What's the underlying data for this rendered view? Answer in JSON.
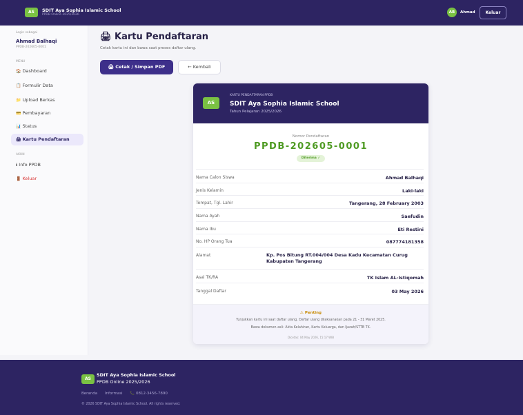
{
  "topbar": {
    "logo": "AS",
    "school_name": "SDIT Aya Sophia Islamic School",
    "subtitle": "PPDB Online 2025/2026",
    "avatar": "AB",
    "user_name": "Ahmad",
    "logout_label": "Keluar"
  },
  "sidebar": {
    "login_as_label": "Login sebagai",
    "user_name": "Ahmad Balhaqi",
    "reg_id": "PPDB-202605-0001",
    "menu_heading": "MENU",
    "menu_items": [
      {
        "icon": "home-icon",
        "glyph": "🏠",
        "label": "Dashboard"
      },
      {
        "icon": "form-icon",
        "glyph": "📋",
        "label": "Formulir Data"
      },
      {
        "icon": "upload-icon",
        "glyph": "📁",
        "label": "Upload Berkas"
      },
      {
        "icon": "payment-icon",
        "glyph": "💳",
        "label": "Pembayaran"
      },
      {
        "icon": "status-icon",
        "glyph": "📊",
        "label": "Status"
      },
      {
        "icon": "printer-icon",
        "glyph": "🖨",
        "label": "Kartu Pendaftaran"
      }
    ],
    "account_heading": "AKUN",
    "account_items": [
      {
        "icon": "info-icon",
        "glyph": "ℹ",
        "label": "Info PPDB"
      },
      {
        "icon": "logout-icon",
        "glyph": "🚪",
        "label": "Keluar"
      }
    ]
  },
  "main": {
    "title_icon": "🖨",
    "title": "Kartu Pendaftaran",
    "subtitle": "Cetak kartu ini dan bawa saat proses daftar ulang.",
    "print_button": "🖨 Cetak / Simpan PDF",
    "back_button": "← Kembali"
  },
  "card": {
    "logo": "AS",
    "header_small": "KARTU PENDAFTARAN PPDB",
    "school_name": "SDIT Aya Sophia Islamic School",
    "year": "Tahun Pelajaran 2025/2026",
    "reg_label": "Nomor Pendaftaran",
    "reg_number": "PPDB-202605-0001",
    "status": "Diterima ✓",
    "rows": [
      {
        "label": "Nama Calon Siswa",
        "value": "Ahmad Balhaqi"
      },
      {
        "label": "Jenis Kelamin",
        "value": "Laki-laki"
      },
      {
        "label": "Tempat, Tgl. Lahir",
        "value": "Tangerang, 28 February 2003"
      },
      {
        "label": "Nama Ayah",
        "value": "Saefudin"
      },
      {
        "label": "Nama Ibu",
        "value": "Eti Restini"
      },
      {
        "label": "No. HP Orang Tua",
        "value": "087774181358"
      },
      {
        "label": "Alamat",
        "value": "Kp. Pos Bitung RT.004/004 Desa Kadu Kecamatan Curug Kabupaten Tangerang"
      },
      {
        "label": "Asal TK/RA",
        "value": "TK Islam AL-Istiqomah"
      },
      {
        "label": "Tanggal Daftar",
        "value": "03 May 2026"
      }
    ],
    "note_title": "⚠ Penting",
    "note_line1": "Tunjukkan kartu ini saat daftar ulang. Daftar ulang dilaksanakan pada 21 - 31 Maret 2025.",
    "note_line2": "Bawa dokumen asli: Akta Kelahiran, Kartu Keluarga, dan Ijazah/STTB TK.",
    "printed_at": "Dicetak: 04 May 2026, 15:17 WIB"
  },
  "footer": {
    "logo": "AS",
    "school_name": "SDIT Aya Sophia Islamic School",
    "subtitle": "PPDB Online 2025/2026",
    "links": [
      "Beranda",
      "Informasi",
      "📞 0812-3456-7890"
    ],
    "copyright": "© 2026 SDIT Aya Sophia Islamic School. All rights reserved."
  }
}
